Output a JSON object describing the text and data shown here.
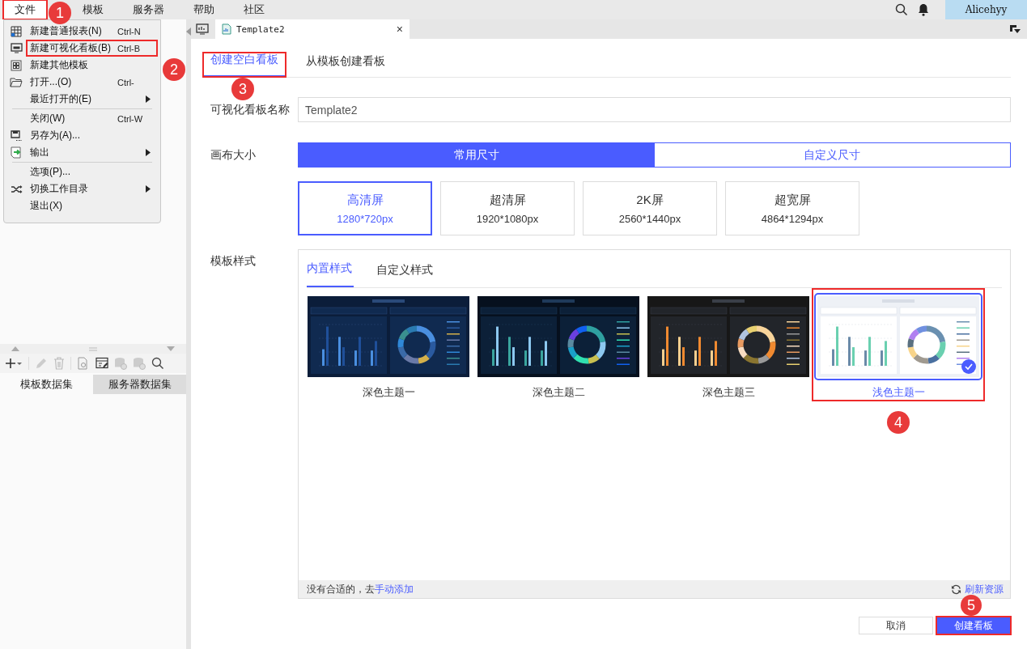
{
  "menubar": {
    "items": [
      {
        "label": "文件",
        "selected": true,
        "highlighted": true,
        "badge": "1"
      },
      {
        "label": "模板",
        "selected": false
      },
      {
        "label": "服务器",
        "selected": false
      },
      {
        "label": "帮助",
        "selected": false
      },
      {
        "label": "社区",
        "selected": false
      }
    ],
    "user": "Alicehyy"
  },
  "file_menu": {
    "items": [
      {
        "kind": "item",
        "label": "新建普通报表(N)",
        "shortcut": "Ctrl-N",
        "submenu": false
      },
      {
        "kind": "item",
        "label": "新建可视化看板(B)",
        "shortcut": "Ctrl-B",
        "submenu": false,
        "highlighted": true,
        "badge": "2"
      },
      {
        "kind": "item",
        "label": "新建其他模板",
        "submenu": false
      },
      {
        "kind": "item",
        "label": "打开...(O)",
        "shortcut": "Ctrl-",
        "submenu": false
      },
      {
        "kind": "item",
        "label": "最近打开的(E)",
        "submenu": true
      },
      {
        "kind": "separator"
      },
      {
        "kind": "item",
        "label": "关闭(W)",
        "shortcut": "Ctrl-W",
        "submenu": false
      },
      {
        "kind": "item",
        "label": "另存为(A)...",
        "submenu": false
      },
      {
        "kind": "item",
        "label": "输出",
        "submenu": true
      },
      {
        "kind": "separator"
      },
      {
        "kind": "item",
        "label": "选项(P)...",
        "submenu": false
      },
      {
        "kind": "item",
        "label": "切换工作目录",
        "submenu": true
      },
      {
        "kind": "item",
        "label": "退出(X)",
        "submenu": false
      }
    ]
  },
  "dataset_panel": {
    "tabs": [
      {
        "label": "模板数据集",
        "selected": true
      },
      {
        "label": "服务器数据集",
        "selected": false
      }
    ]
  },
  "editor_tab": {
    "title": "Template2",
    "close": "×"
  },
  "dialog": {
    "tabs": [
      {
        "label": "创建空白看板",
        "selected": true,
        "highlighted": true,
        "badge": "3"
      },
      {
        "label": "从模板创建看板",
        "selected": false
      }
    ],
    "name_field": {
      "label": "可视化看板名称",
      "value": "Template2"
    },
    "canvas_size": {
      "label": "画布大小",
      "options": [
        {
          "label": "常用尺寸",
          "selected": true
        },
        {
          "label": "自定义尺寸",
          "selected": false
        }
      ],
      "presets": [
        {
          "name": "高清屏",
          "size": "1280*720px",
          "selected": true
        },
        {
          "name": "超清屏",
          "size": "1920*1080px",
          "selected": false
        },
        {
          "name": "2K屏",
          "size": "2560*1440px",
          "selected": false
        },
        {
          "name": "超宽屏",
          "size": "4864*1294px",
          "selected": false
        }
      ]
    },
    "template_style": {
      "label": "模板样式",
      "tabs": [
        {
          "label": "内置样式",
          "selected": true
        },
        {
          "label": "自定义样式",
          "selected": false
        }
      ],
      "themes": [
        {
          "name": "深色主题一",
          "kind": "dark-blue",
          "selected": false
        },
        {
          "name": "深色主题二",
          "kind": "dark-teal",
          "selected": false
        },
        {
          "name": "深色主题三",
          "kind": "dark-gold",
          "selected": false
        },
        {
          "name": "浅色主题一",
          "kind": "light",
          "selected": true,
          "highlighted": true,
          "badge": "4"
        }
      ],
      "footer": {
        "text": "没有合适的，去",
        "link": "手动添加",
        "refresh": "刷新资源"
      }
    },
    "buttons": [
      {
        "label": "取消",
        "kind": "secondary"
      },
      {
        "label": "创建看板",
        "kind": "primary",
        "highlighted": true,
        "badge": "5"
      }
    ]
  }
}
